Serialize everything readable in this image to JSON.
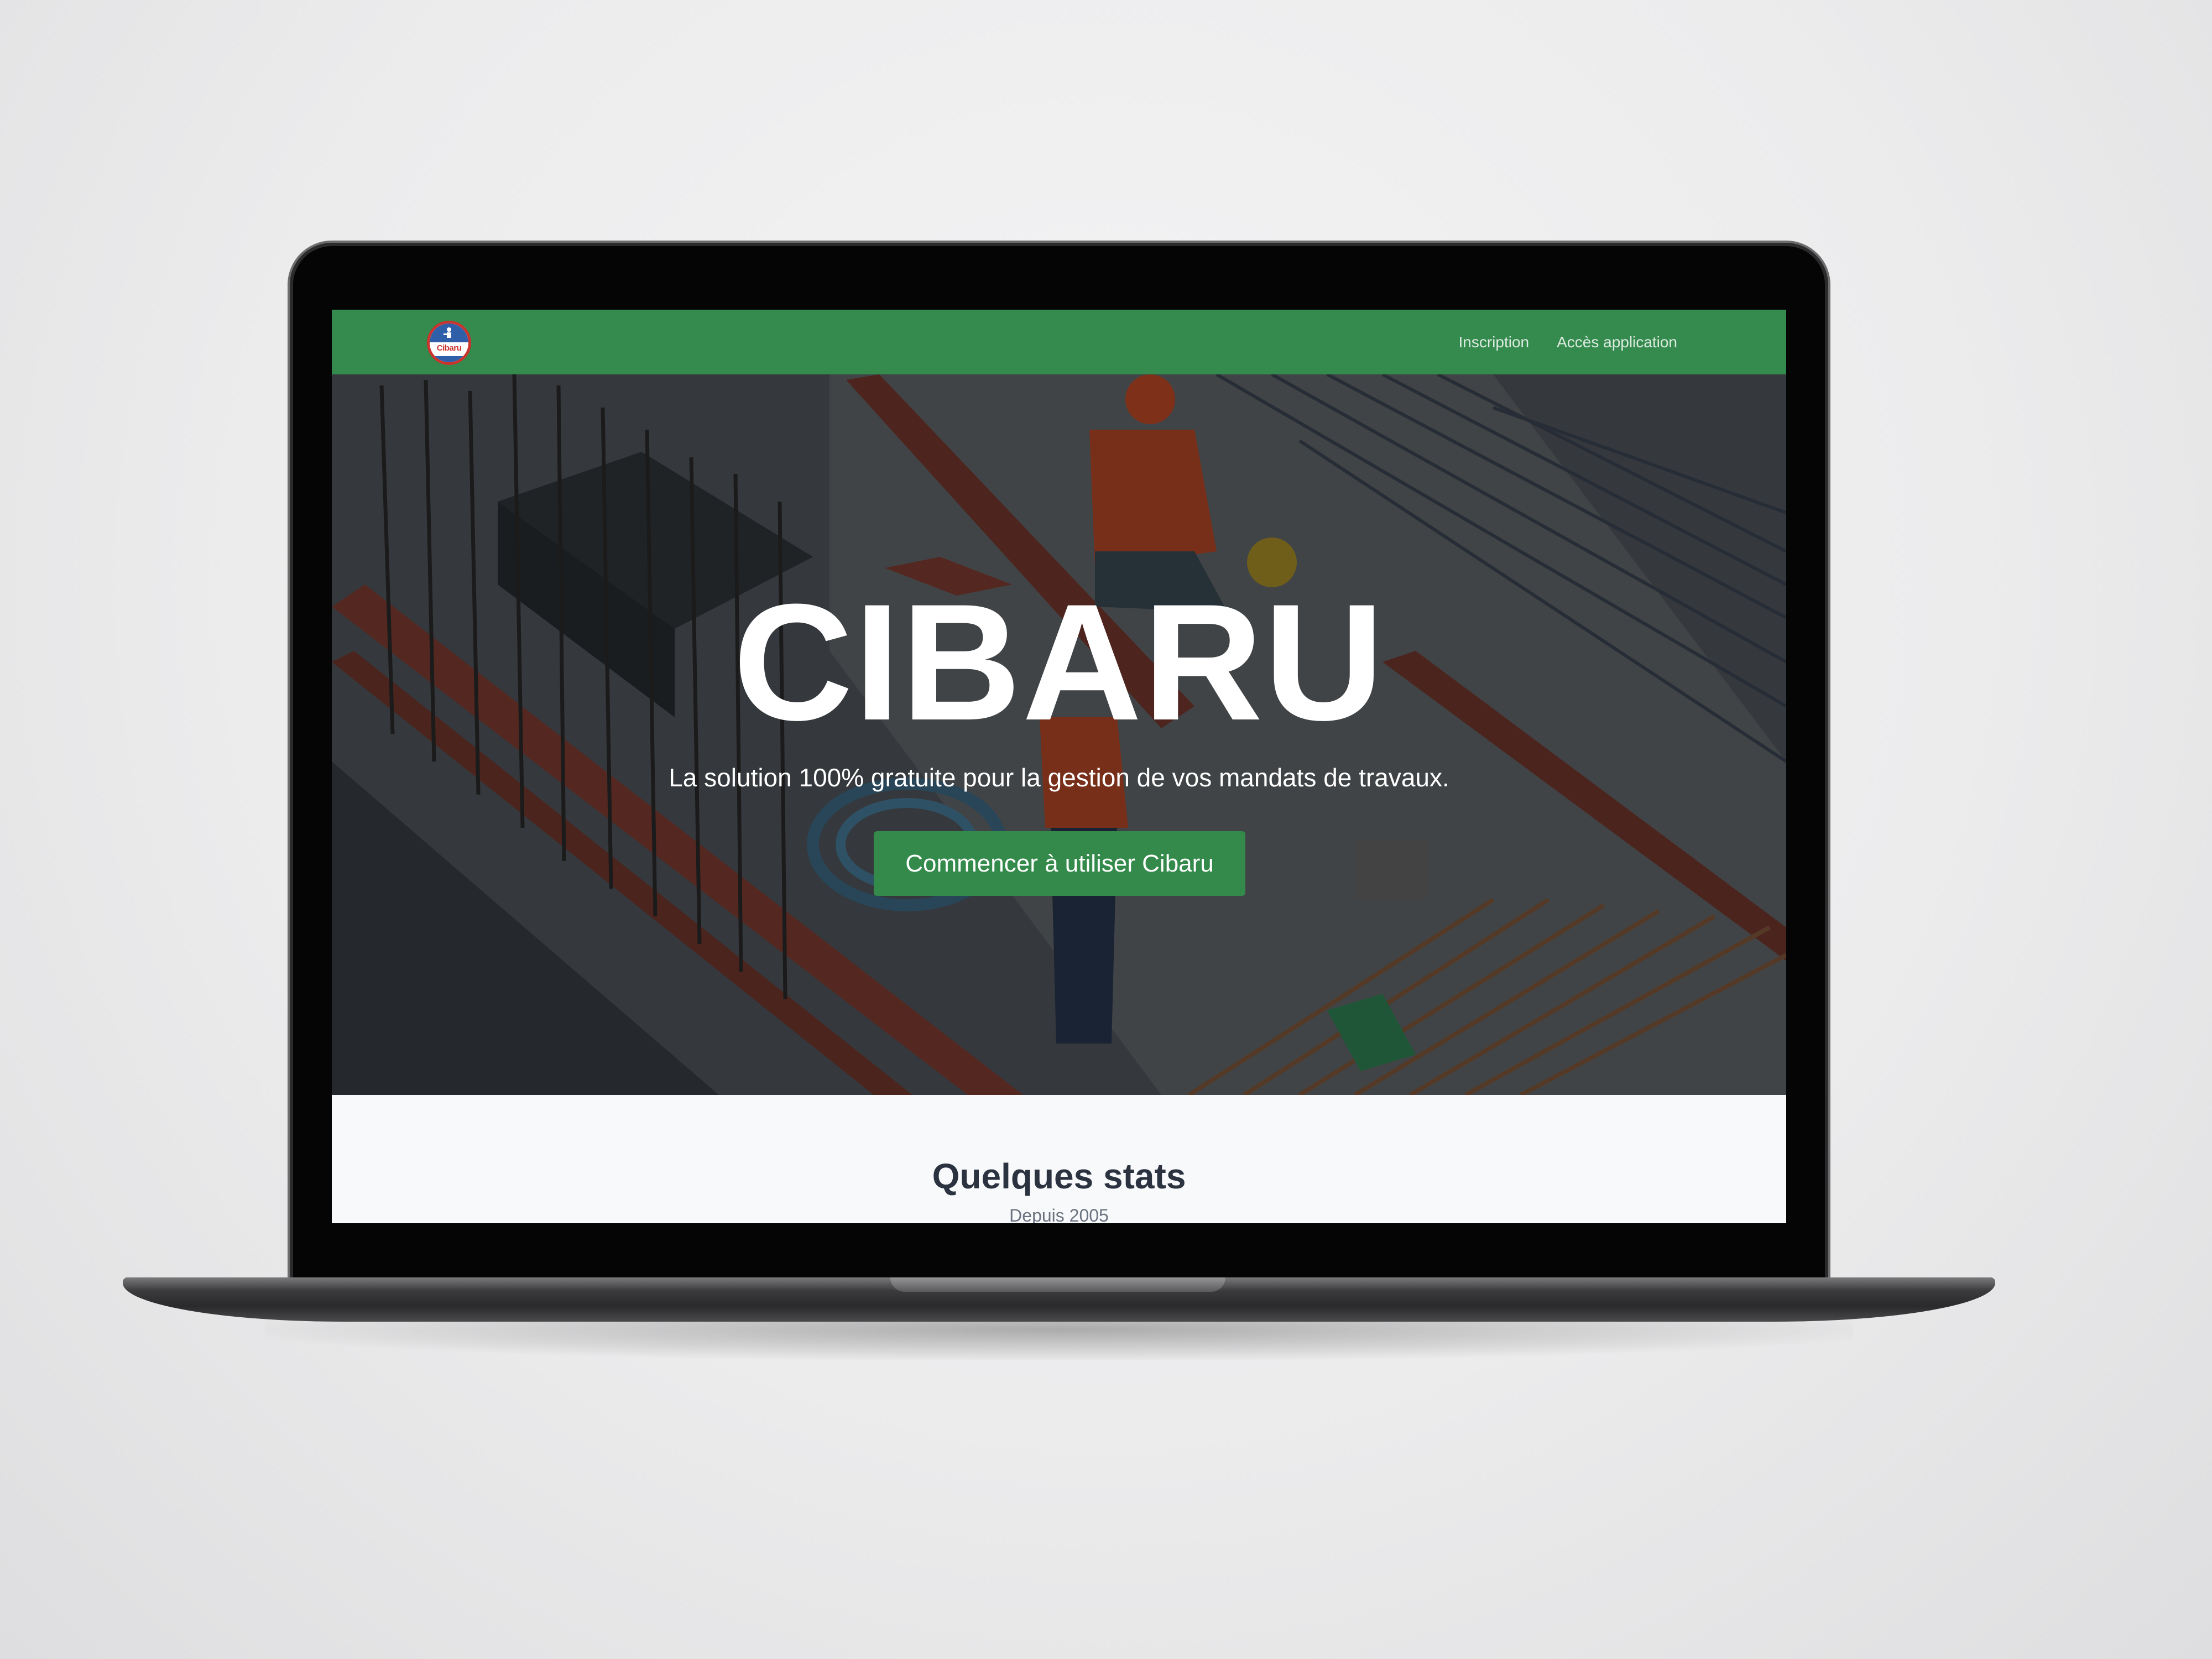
{
  "navbar": {
    "logo_text": "Cibaru",
    "links": [
      {
        "label": "Inscription"
      },
      {
        "label": "Accès application"
      }
    ],
    "background": "#358a4e"
  },
  "hero": {
    "title": "CIBARU",
    "subtitle": "La solution 100% gratuite pour la gestion de vos mandats de travaux.",
    "cta_label": "Commencer à utiliser Cibaru",
    "cta_color": "#348a4b"
  },
  "stats": {
    "title": "Quelques stats",
    "subtitle": "Depuis 2005"
  }
}
